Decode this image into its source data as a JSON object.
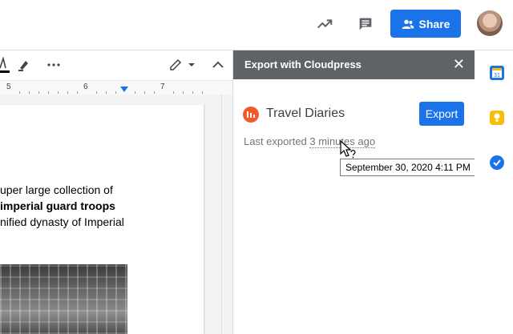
{
  "topbar": {
    "share_label": "Share",
    "icons": [
      "trending-icon",
      "comment-icon",
      "avatar"
    ]
  },
  "toolbar": {
    "icons": [
      "text-color-icon",
      "highlight-icon",
      "more-icon",
      "edit-mode-icon",
      "collapse-icon"
    ]
  },
  "ruler": {
    "labels": [
      "5",
      "6",
      "7"
    ]
  },
  "document": {
    "lines": [
      {
        "text": "uper large collection of",
        "bold": false
      },
      {
        "text": "imperial guard troops",
        "bold": true
      },
      {
        "text": "nified dynasty of Imperial",
        "bold": false
      }
    ]
  },
  "panel": {
    "title": "Export with Cloudpress",
    "doc_title": "Travel Diaries",
    "export_label": "Export",
    "last_exported_prefix": "Last exported ",
    "last_exported_time": "3 minutes ago",
    "tooltip": "September 30, 2020 4:11 PM"
  },
  "colors": {
    "primary": "#1a73e8",
    "panel_header": "#5f6368",
    "cloudpress": "#f15a2b"
  }
}
